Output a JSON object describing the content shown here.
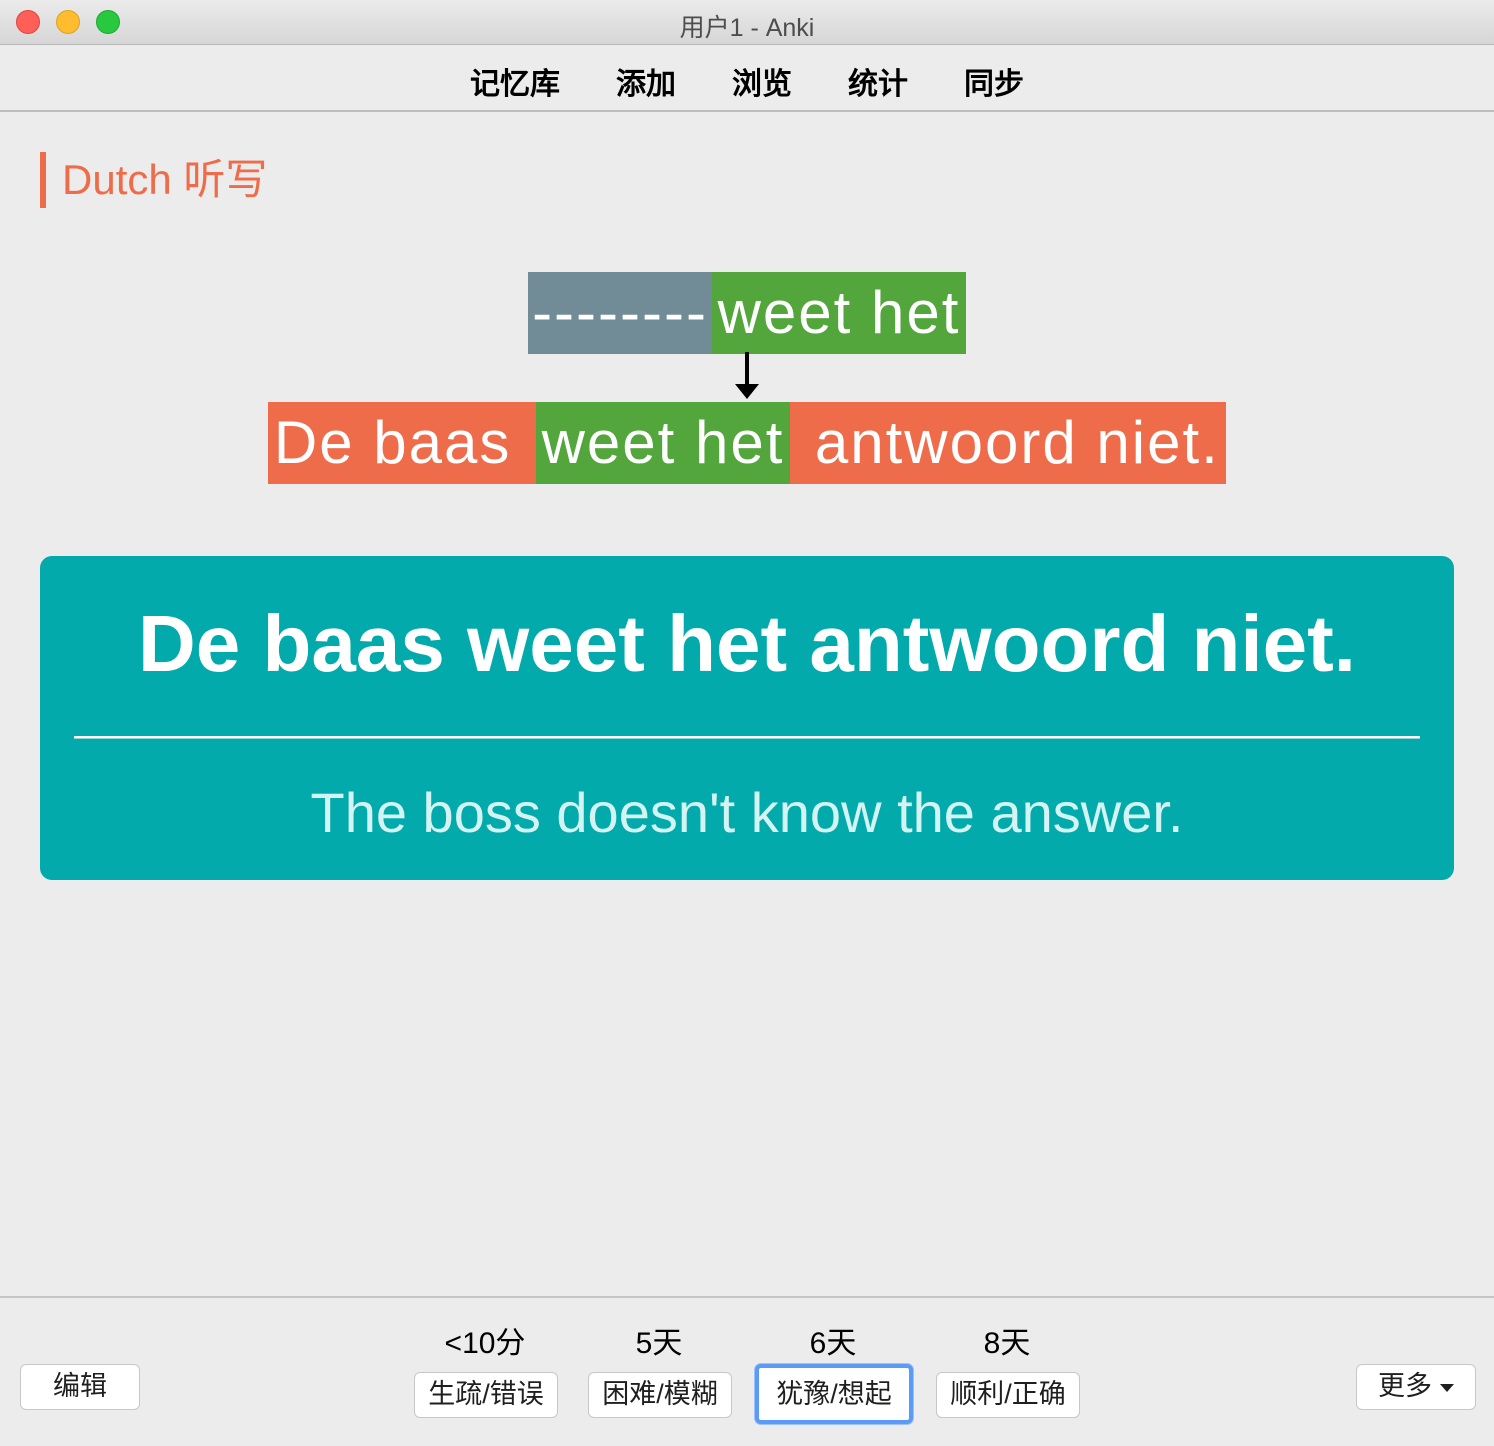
{
  "window": {
    "title": "用户1 - Anki"
  },
  "toolbar": {
    "items": [
      "记忆库",
      "添加",
      "浏览",
      "统计",
      "同步"
    ]
  },
  "deck": {
    "label": "Dutch 听写"
  },
  "typed_answer": {
    "row1": [
      "--------",
      "weet het"
    ],
    "row2": [
      "De baas ",
      "weet het",
      " antwoord niet."
    ]
  },
  "card": {
    "front": "De baas weet het antwoord niet.",
    "back": "The boss doesn't know the answer."
  },
  "bottom": {
    "edit_label": "编辑",
    "more_label": "更多",
    "intervals": [
      "<10分",
      "5天",
      "6天",
      "8天"
    ],
    "answers": [
      "生疏/错误",
      "困难/模糊",
      "犹豫/想起",
      "顺利/正确"
    ]
  },
  "colors": {
    "accent": "#ef6c4a",
    "correct": "#52a63c",
    "missing": "#718b97",
    "card_bg": "#02aaab",
    "focus": "#5b9af5"
  },
  "icons": [
    "chevron-down-icon",
    "arrow-down-icon"
  ]
}
